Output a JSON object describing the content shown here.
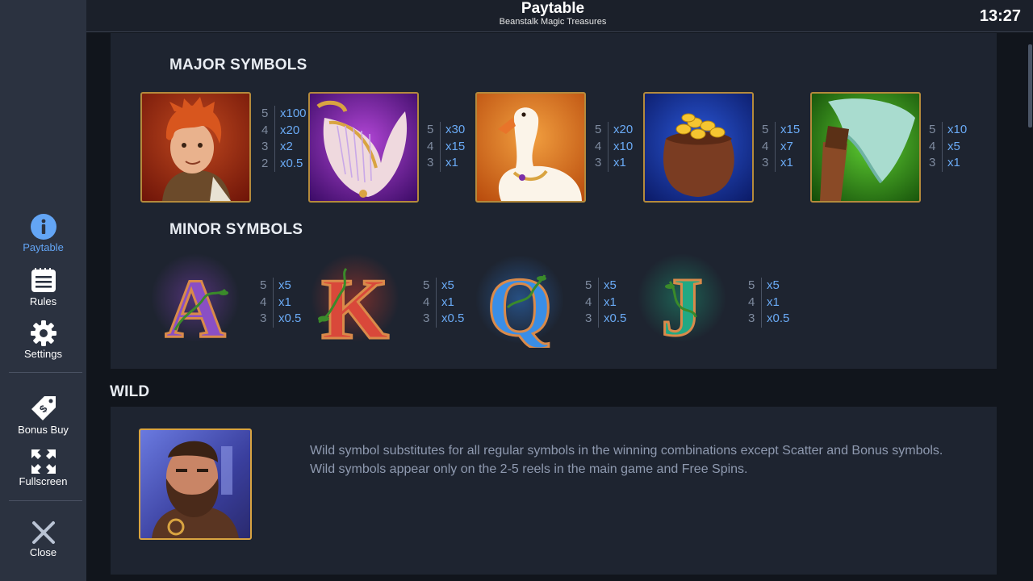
{
  "header": {
    "title": "Paytable",
    "subtitle": "Beanstalk Magic Treasures",
    "clock": "13:27"
  },
  "sidebar": {
    "items": [
      {
        "label": "Paytable",
        "icon": "info-icon",
        "active": true
      },
      {
        "label": "Rules",
        "icon": "rules-icon"
      },
      {
        "label": "Settings",
        "icon": "gear-icon"
      },
      {
        "label": "Bonus Buy",
        "icon": "price-tag-icon"
      },
      {
        "label": "Fullscreen",
        "icon": "fullscreen-icon"
      },
      {
        "label": "Close",
        "icon": "close-icon"
      }
    ]
  },
  "major": {
    "title": "MAJOR SYMBOLS",
    "symbols": [
      {
        "name": "jack-boy",
        "pays": [
          [
            "5",
            "x100"
          ],
          [
            "4",
            "x20"
          ],
          [
            "3",
            "x2"
          ],
          [
            "2",
            "x0.5"
          ]
        ]
      },
      {
        "name": "harp",
        "pays": [
          [
            "5",
            "x30"
          ],
          [
            "4",
            "x15"
          ],
          [
            "3",
            "x1"
          ]
        ]
      },
      {
        "name": "goose",
        "pays": [
          [
            "5",
            "x20"
          ],
          [
            "4",
            "x10"
          ],
          [
            "3",
            "x1"
          ]
        ]
      },
      {
        "name": "gold-sack",
        "pays": [
          [
            "5",
            "x15"
          ],
          [
            "4",
            "x7"
          ],
          [
            "3",
            "x1"
          ]
        ]
      },
      {
        "name": "axe",
        "pays": [
          [
            "5",
            "x10"
          ],
          [
            "4",
            "x5"
          ],
          [
            "3",
            "x1"
          ]
        ]
      }
    ]
  },
  "minor": {
    "title": "MINOR SYMBOLS",
    "symbols": [
      {
        "letter": "A",
        "color": "#7b3fb0",
        "pays": [
          [
            "5",
            "x5"
          ],
          [
            "4",
            "x1"
          ],
          [
            "3",
            "x0.5"
          ]
        ]
      },
      {
        "letter": "K",
        "color": "#c0392b",
        "pays": [
          [
            "5",
            "x5"
          ],
          [
            "4",
            "x1"
          ],
          [
            "3",
            "x0.5"
          ]
        ]
      },
      {
        "letter": "Q",
        "color": "#2f7bd6",
        "pays": [
          [
            "5",
            "x5"
          ],
          [
            "4",
            "x1"
          ],
          [
            "3",
            "x0.5"
          ]
        ]
      },
      {
        "letter": "J",
        "color": "#1f9e78",
        "pays": [
          [
            "5",
            "x5"
          ],
          [
            "4",
            "x1"
          ],
          [
            "3",
            "x0.5"
          ]
        ]
      }
    ]
  },
  "wild": {
    "title": "WILD",
    "line1": "Wild symbol substitutes for all regular symbols in the winning combinations except Scatter and Bonus symbols.",
    "line2": "Wild symbols appear only on the 2-5 reels in the main game and Free Spins."
  },
  "colors": {
    "accent": "#63a5f5",
    "multiplier": "#6aaaf5",
    "panel": "#1e2430",
    "sidebar": "#2b3240"
  }
}
